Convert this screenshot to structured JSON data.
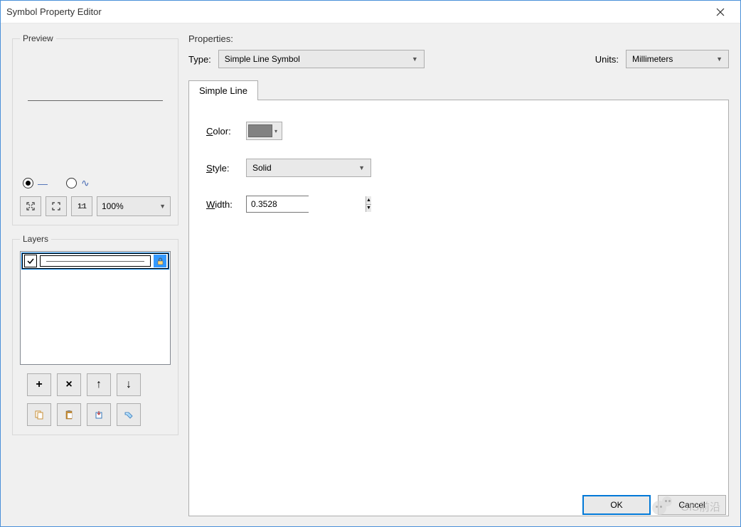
{
  "window": {
    "title": "Symbol Property Editor"
  },
  "preview": {
    "legend": "Preview",
    "zoom": "100%",
    "mode_line_checked": true,
    "mode_zigzag_checked": false
  },
  "layers": {
    "legend": "Layers"
  },
  "properties": {
    "label": "Properties:",
    "type_label": "Type:",
    "type_value": "Simple Line Symbol",
    "units_label": "Units:",
    "units_value": "Millimeters",
    "tab": "Simple Line",
    "color_label": "Color:",
    "color_value": "#828282",
    "style_label": "Style:",
    "style_value": "Solid",
    "width_label": "Width:",
    "width_value": "0.3528"
  },
  "buttons": {
    "ok": "OK",
    "cancel": "Cancel"
  },
  "watermark": "GIS前沿"
}
